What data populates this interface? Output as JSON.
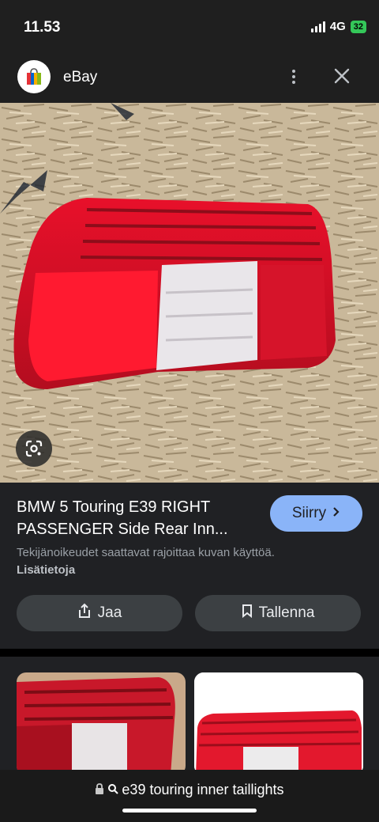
{
  "status": {
    "time": "11.53",
    "network": "4G",
    "battery": "32"
  },
  "header": {
    "app_name": "eBay",
    "logo_icon": "ebay-bag-icon",
    "menu_icon": "more-vert-icon",
    "close_icon": "close-icon"
  },
  "image": {
    "description_icon": "google-lens-icon"
  },
  "result": {
    "title": "BMW 5 Touring E39 RIGHT PASSENGER Side Rear Inn...",
    "visit_label": "Siirry",
    "copyright_text": "Tekijänoikeudet saattavat rajoittaa kuvan käyttöä.",
    "more_info_label": "Lisätietoja",
    "share_label": "Jaa",
    "save_label": "Tallenna"
  },
  "bottom": {
    "url_text": "e39 touring inner taillights"
  },
  "colors": {
    "accent": "#8ab4f8",
    "background": "#202124",
    "button": "#3c4043"
  }
}
